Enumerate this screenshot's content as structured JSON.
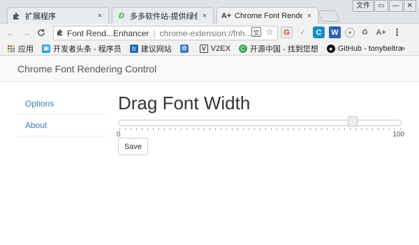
{
  "window": {
    "controls": [
      "文件",
      "▭",
      "—",
      "✕"
    ]
  },
  "tabs": [
    {
      "title": "扩展程序",
      "icon": "puzzle-icon",
      "active": false
    },
    {
      "title": "多多软件站-提供绿色软",
      "icon": "site-d-icon",
      "active": false
    },
    {
      "title": "Chrome Font Rendering",
      "icon": "font-a-icon",
      "active": true
    }
  ],
  "tab_close_label": "×",
  "omnibox": {
    "site_name": "Font Rend...Enhancer",
    "url": "chrome-extension://fnh..."
  },
  "bookmarks": {
    "apps_label": "应用",
    "items": [
      {
        "label": "开发者头条 - 程序员",
        "color": "#2f9ee0"
      },
      {
        "label": "建议网站",
        "color": "#1c6fb5"
      },
      {
        "label": "",
        "color": "#3a7bc8"
      },
      {
        "label": "V2EX",
        "color": "#333333"
      },
      {
        "label": "开源中国 - 找到您想",
        "color": "#3aa55a"
      },
      {
        "label": "GitHub - tonybeltra",
        "color": "#111111"
      }
    ],
    "more": "»"
  },
  "page": {
    "brand": "Chrome Font Rendering Control",
    "nav": [
      "Options",
      "About"
    ],
    "heading": "Drag Font Width",
    "slider": {
      "min": 0,
      "max": 100,
      "value": 84,
      "min_label": "0",
      "max_label": "100"
    },
    "save_label": "Save"
  },
  "colors": {
    "link": "#337ab7",
    "header_bg": "#f8f8f8",
    "chrome_bg": "#f2f2f2"
  }
}
